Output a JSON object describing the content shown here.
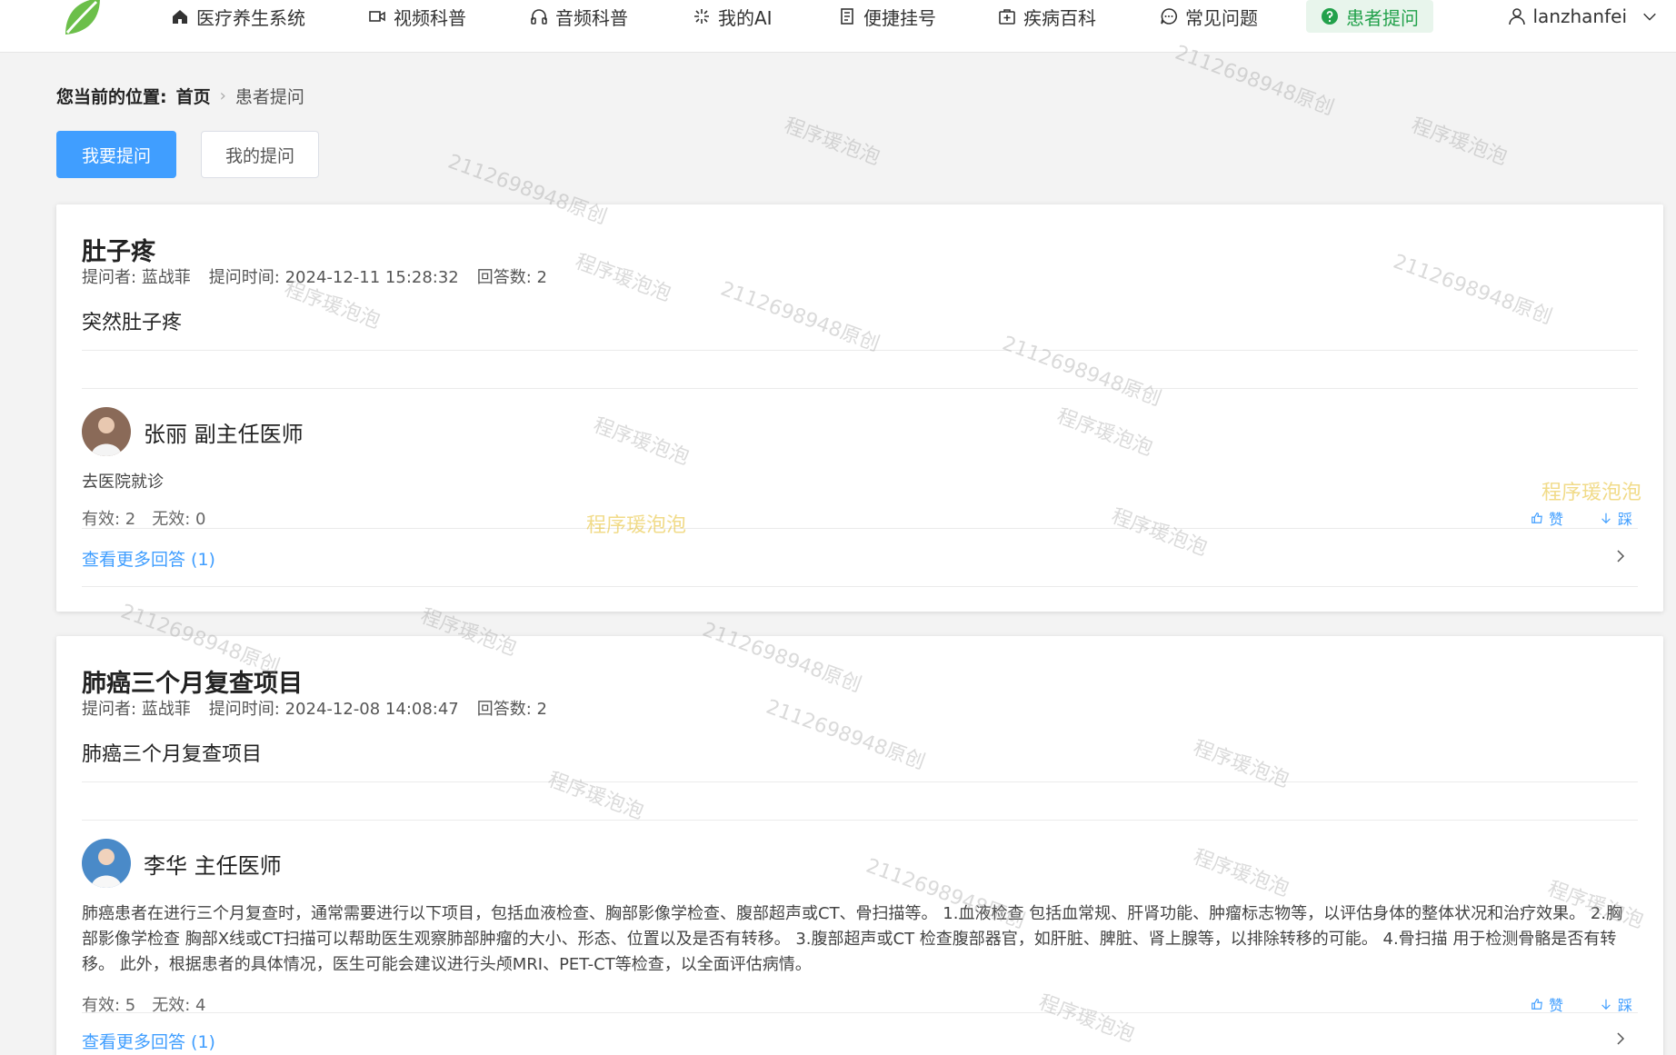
{
  "nav": {
    "items": [
      {
        "label": "医疗养生系统",
        "icon": "home-icon"
      },
      {
        "label": "视频科普",
        "icon": "video-icon"
      },
      {
        "label": "音频科普",
        "icon": "headphones-icon"
      },
      {
        "label": "我的AI",
        "icon": "sparkle-icon"
      },
      {
        "label": "便捷挂号",
        "icon": "register-icon"
      },
      {
        "label": "疾病百科",
        "icon": "medical-kit-icon"
      },
      {
        "label": "常见问题",
        "icon": "chat-icon"
      },
      {
        "label": "患者提问",
        "icon": "question-circle-icon"
      }
    ],
    "active": "患者提问",
    "user": "lanzhanfei"
  },
  "breadcrumb": {
    "prefix": "您当前的位置:",
    "home": "首页",
    "current": "患者提问"
  },
  "actions": {
    "ask": "我要提问",
    "mine": "我的提问"
  },
  "questions": [
    {
      "title": "肚子疼",
      "asker": "提问者: 蓝战菲",
      "time": "提问时间: 2024-12-11 15:28:32",
      "answers": "回答数: 2",
      "body": "突然肚子疼",
      "doctor": "张丽  副主任医师",
      "answer": "去医院就诊",
      "valid": "有效: 2",
      "invalid": "无效: 0",
      "like": "赞",
      "dislike": "踩",
      "more": "查看更多回答 (1)"
    },
    {
      "title": "肺癌三个月复查项目",
      "asker": "提问者: 蓝战菲",
      "time": "提问时间: 2024-12-08 14:08:47",
      "answers": "回答数: 2",
      "body": "肺癌三个月复查项目",
      "doctor": "李华  主任医师",
      "answer": "肺癌患者在进行三个月复查时，通常需要进行以下项目，包括血液检查、胸部影像学检查、腹部超声或CT、骨扫描等。 1.血液检查 包括血常规、肝肾功能、肿瘤标志物等，以评估身体的整体状况和治疗效果。 2.胸部影像学检查 胸部X线或CT扫描可以帮助医生观察肺部肿瘤的大小、形态、位置以及是否有转移。 3.腹部超声或CT 检查腹部器官，如肝脏、脾脏、肾上腺等，以排除转移的可能。 4.骨扫描 用于检测骨骼是否有转移。 此外，根据患者的具体情况，医生可能会建议进行头颅MRI、PET-CT等检查，以全面评估病情。",
      "valid": "有效: 5",
      "invalid": "无效: 4",
      "like": "赞",
      "dislike": "踩",
      "more": "查看更多回答 (1)"
    }
  ],
  "watermark": {
    "a": "程序瑗泡泡",
    "b": "2112698948原创"
  },
  "colors": {
    "accent": "#409eff",
    "active_nav": "#22a14b",
    "logo": "#6cbf4a"
  }
}
